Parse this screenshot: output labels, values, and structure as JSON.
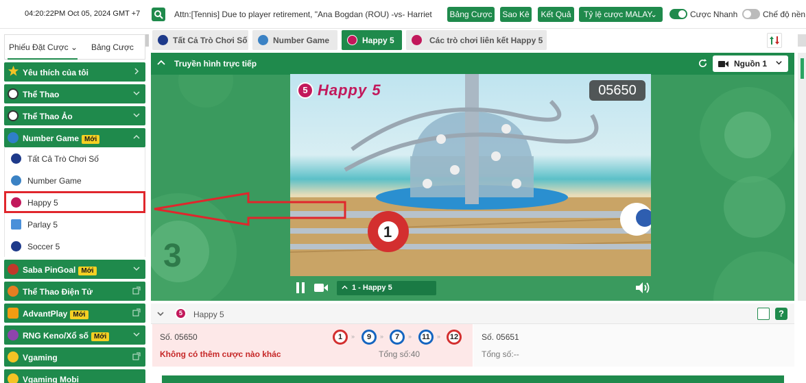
{
  "topbar": {
    "datetime": "04:20:22PM Oct 05, 2024 GMT +7",
    "ticker": "Attn:[Tennis] Due to player retirement, \"Ana Bogdan (ROU) -vs- Harriet",
    "buttons": [
      "Bảng Cược",
      "Sao Kê",
      "Kết Quả",
      "Tỷ lệ cược MALAY"
    ],
    "toggle_quick": "Cược Nhanh",
    "toggle_mode": "Chế độ nền"
  },
  "left": {
    "tabs": [
      "Phiếu Đặt Cược",
      "Bảng Cược"
    ],
    "menu": [
      {
        "label": "Yêu thích của tôi",
        "badge": ""
      },
      {
        "label": "Thể Thao",
        "badge": ""
      },
      {
        "label": "Thể Thao Ảo",
        "badge": ""
      },
      {
        "label": "Number Game",
        "badge": "Mới"
      }
    ],
    "submenu": [
      "Tất Cả Trò Chơi Số",
      "Number Game",
      "Happy 5",
      "Parlay 5",
      "Soccer 5"
    ],
    "menu2": [
      {
        "label": "Saba PinGoal",
        "badge": "Mới"
      },
      {
        "label": "Thể Thao Điện Tử",
        "badge": ""
      },
      {
        "label": "AdvantPlay",
        "badge": "Mới"
      },
      {
        "label": "RNG Keno/Xổ số",
        "badge": "Mới"
      },
      {
        "label": "Vgaming",
        "badge": ""
      },
      {
        "label": "Vgaming Mobi",
        "badge": ""
      }
    ]
  },
  "tabs": [
    "Tất Cả Trò Chơi Số",
    "Number Game",
    "Happy 5",
    "Các trò chơi liên kết Happy 5"
  ],
  "stream": {
    "header": "Truyền hình trực tiếp",
    "source": "Nguồn 1",
    "game_title": "Happy 5",
    "counter": "05650",
    "episode": "1 - Happy 5"
  },
  "info": {
    "title": "Happy 5",
    "left_no": "Số. 05650",
    "left_warning": "Không có thêm cược nào khác",
    "balls": [
      "1",
      "9",
      "7",
      "11",
      "12"
    ],
    "left_total": "Tổng số:40",
    "right_no": "Số. 05651",
    "right_total": "Tổng số:--"
  },
  "colors": {
    "brand": "#1f8a4c",
    "badge": "#f4d023",
    "highlight": "#e0262c"
  }
}
